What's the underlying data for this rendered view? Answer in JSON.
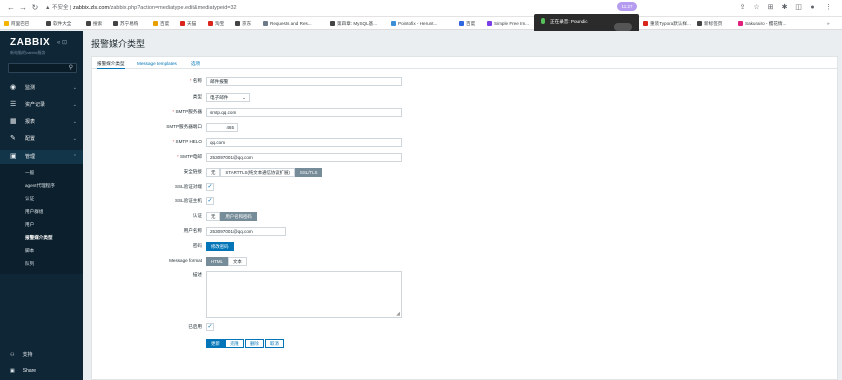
{
  "browser": {
    "insecure_label": "不安全",
    "url_host": "zabbix.zls.com",
    "url_path": "/zabbix.php?action=mediatype.edit&mediatypeid=32",
    "profile_label": "11:27",
    "bookmarks": [
      "阿里巴巴",
      "软件大全",
      "搜索",
      "苏宁易购",
      "百度",
      "天猫",
      "淘宝",
      "京东",
      "Requests and Res...",
      "第四章: MySQL基...",
      "Pointofix - Herunt...",
      "百度",
      "Simple Free Im...",
      "重装Typora默认样...",
      "新标签页",
      "Sakurairo - 樱花情..."
    ],
    "more_label": "»",
    "recording_label": "正在录音: Poundic"
  },
  "sidebar": {
    "logo": "ZABBIX",
    "subtitle": "新电脑的zabbix服务",
    "collapse_label": "« ⊡",
    "menu": [
      {
        "label": "监测",
        "icon": "eye-icon"
      },
      {
        "label": "资产记录",
        "icon": "list-icon"
      },
      {
        "label": "报表",
        "icon": "report-icon"
      },
      {
        "label": "配置",
        "icon": "wrench-icon"
      },
      {
        "label": "管理",
        "icon": "admin-icon"
      }
    ],
    "submenu": [
      "一般",
      "agent代理程序",
      "认证",
      "用户群组",
      "用户",
      "报警媒介类型",
      "脚本",
      "队列"
    ],
    "bottom": [
      {
        "label": "支持",
        "icon": "support-icon"
      },
      {
        "label": "Share",
        "icon": "share-icon"
      }
    ]
  },
  "main": {
    "title": "报警媒介类型",
    "tabs": [
      "报警媒介类型",
      "Message templates",
      "选项"
    ],
    "form": {
      "name_label": "名称",
      "name_value": "邮件报警",
      "type_label": "类型",
      "type_value": "电子邮件",
      "smtp_server_label": "SMTP服务器",
      "smtp_server_value": "smtp.qq.com",
      "smtp_port_label": "SMTP服务器端口",
      "smtp_port_value": "465",
      "smtp_helo_label": "SMTP HELO",
      "smtp_helo_value": "qq.com",
      "smtp_email_label": "SMTP电邮",
      "smtp_email_value": "253097001@qq.com",
      "security_label": "安全链接",
      "security_options": [
        "无",
        "STARTTLS(纯文本通信协议扩展)",
        "SSL/TLS"
      ],
      "security_selected": "SSL/TLS",
      "ssl_verify_peer_label": "SSL验证对端",
      "ssl_verify_host_label": "SSL验证主机",
      "auth_label": "认证",
      "auth_options": [
        "无",
        "用户名和密码"
      ],
      "auth_selected": "用户名和密码",
      "username_label": "用户名称",
      "username_value": "253097001@qq.com",
      "password_label": "密码",
      "password_button": "修改密码",
      "format_label": "Message format",
      "format_options": [
        "HTML",
        "文本"
      ],
      "format_selected": "HTML",
      "description_label": "描述",
      "enabled_label": "已启用",
      "buttons": {
        "update": "更新",
        "clone": "克隆",
        "delete": "删除",
        "cancel": "取消"
      }
    }
  },
  "colors": {
    "sidebar_bg": "#0f2636",
    "accent": "#0275b8",
    "required": "#e45959"
  }
}
